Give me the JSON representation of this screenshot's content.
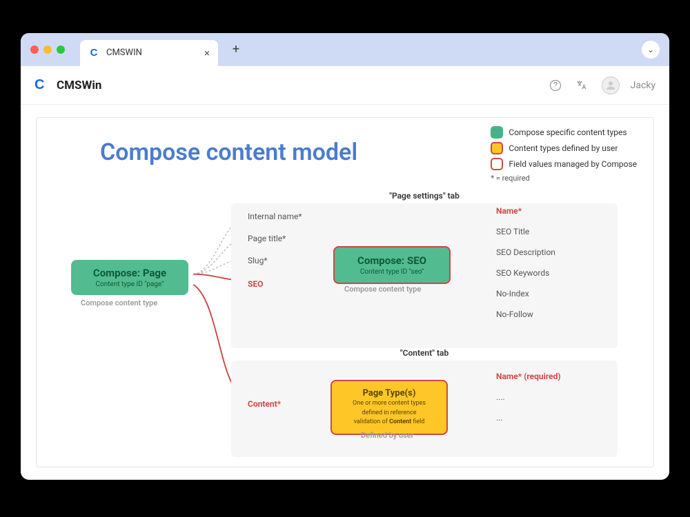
{
  "browser": {
    "tab_title": "CMSWIN",
    "close_glyph": "×",
    "newtab_glyph": "+",
    "chevron_glyph": "⌄"
  },
  "header": {
    "brand": "CMSWin",
    "user_name": "Jacky"
  },
  "page": {
    "title": "Compose content model"
  },
  "legend": {
    "items": [
      {
        "label": "Compose specific content types",
        "color": "green"
      },
      {
        "label": "Content types defined by user",
        "color": "yellow"
      },
      {
        "label": "Field values managed by Compose",
        "color": "red"
      }
    ],
    "note": "* = required"
  },
  "diagram": {
    "page_node": {
      "title": "Compose: Page",
      "subtitle": "Content type ID \"page\"",
      "caption": "Compose content type"
    },
    "tabs": {
      "settings": {
        "label": "\"Page settings\" tab",
        "fields": [
          {
            "label": "Internal name*",
            "red": false
          },
          {
            "label": "Page title*",
            "red": false
          },
          {
            "label": "Slug*",
            "red": false
          },
          {
            "label": "SEO",
            "red": true
          }
        ],
        "seo_node": {
          "title": "Compose: SEO",
          "subtitle": "Content type ID \"seo\"",
          "caption": "Compose content type",
          "out_fields": [
            {
              "label": "Name*",
              "red": true
            },
            {
              "label": "SEO Title",
              "red": false
            },
            {
              "label": "SEO Description",
              "red": false
            },
            {
              "label": "SEO Keywords",
              "red": false
            },
            {
              "label": "No-Index",
              "red": false
            },
            {
              "label": "No-Follow",
              "red": false
            }
          ]
        }
      },
      "content": {
        "label": "\"Content\" tab",
        "entry_field": {
          "label": "Content*",
          "red": true
        },
        "pagetype_node": {
          "title": "Page Type(s)",
          "subtitle_line1": "One or more content types",
          "subtitle_line2": "defined in reference",
          "subtitle_line3": "validation of Content field",
          "caption": "Defined by user",
          "out_fields": [
            {
              "label": "Name* (required)",
              "red": true
            },
            {
              "label": "....",
              "red": false
            },
            {
              "label": "...",
              "red": false
            }
          ]
        }
      }
    }
  }
}
